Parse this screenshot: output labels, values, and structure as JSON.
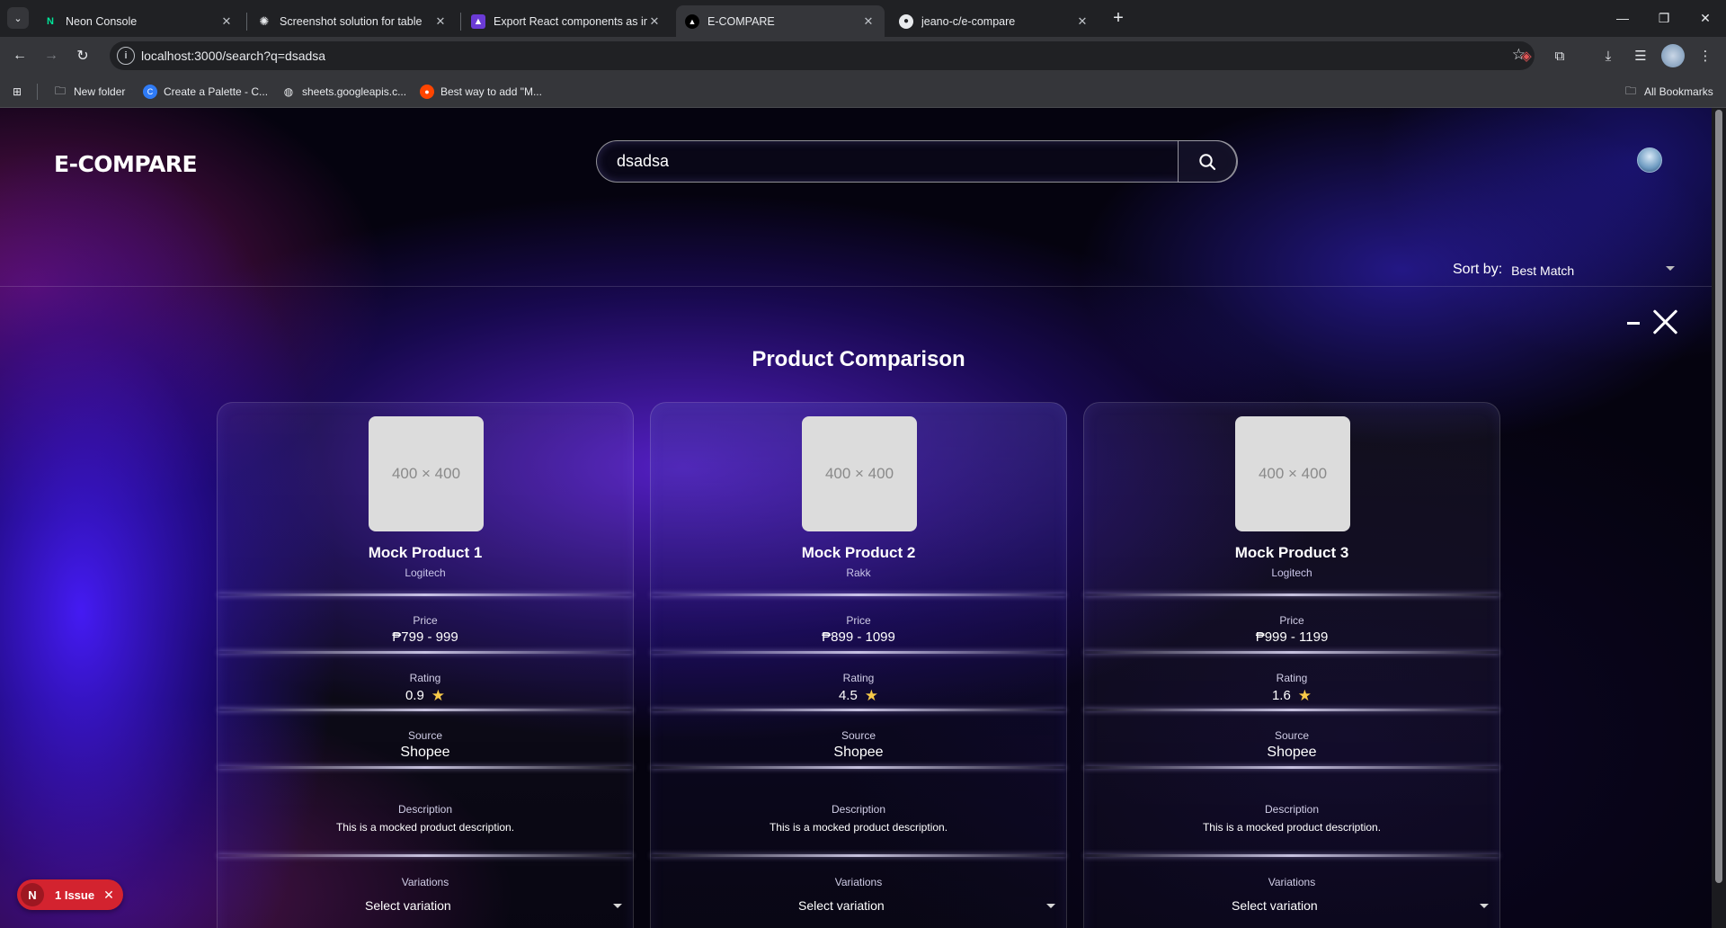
{
  "browser": {
    "tabs": [
      {
        "title": "Neon Console",
        "icon": "neon-logo-icon",
        "active": false
      },
      {
        "title": "Screenshot solution for table",
        "icon": "chatgpt-icon",
        "active": false
      },
      {
        "title": "Export React components as im",
        "icon": "rocket-icon",
        "active": false
      },
      {
        "title": "E-COMPARE",
        "icon": "triangle-logo-icon",
        "active": true
      },
      {
        "title": "jeano-c/e-compare",
        "icon": "github-icon",
        "active": false
      }
    ],
    "url": "localhost:3000/search?q=dsadsa",
    "bookmarks": [
      {
        "label": "New folder",
        "icon": "folder-icon"
      },
      {
        "label": "Create a Palette - C...",
        "icon": "coolors-icon"
      },
      {
        "label": "sheets.googleapis.c...",
        "icon": "globe-icon"
      },
      {
        "label": "Best way to add \"M...",
        "icon": "reddit-icon"
      }
    ],
    "all_bookmarks": "All Bookmarks"
  },
  "header": {
    "logo": "E-COMPARE",
    "search_value": "dsadsa"
  },
  "sort": {
    "label": "Sort by:",
    "value": "Best Match"
  },
  "comparison": {
    "title": "Product Comparison",
    "field_labels": {
      "price": "Price",
      "rating": "Rating",
      "source": "Source",
      "description": "Description",
      "variations": "Variations"
    },
    "products": [
      {
        "image_placeholder": "400 × 400",
        "name": "Mock Product 1",
        "brand": "Logitech",
        "price": "₱799 - 999",
        "rating": "0.9",
        "source": "Shopee",
        "description": "This is a mocked product description.",
        "variation": "Select variation"
      },
      {
        "image_placeholder": "400 × 400",
        "name": "Mock Product 2",
        "brand": "Rakk",
        "price": "₱899 - 1099",
        "rating": "4.5",
        "source": "Shopee",
        "description": "This is a mocked product description.",
        "variation": "Select variation"
      },
      {
        "image_placeholder": "400 × 400",
        "name": "Mock Product 3",
        "brand": "Logitech",
        "price": "₱999 - 1199",
        "rating": "1.6",
        "source": "Shopee",
        "description": "This is a mocked product description.",
        "variation": "Select variation"
      }
    ]
  },
  "dev_overlay": {
    "badge_letter": "N",
    "issues": "1 Issue"
  },
  "colors": {
    "background": "#05030f",
    "accent_purple": "#5a1cff",
    "star": "#f7c948",
    "issue_badge": "#d3232f"
  }
}
